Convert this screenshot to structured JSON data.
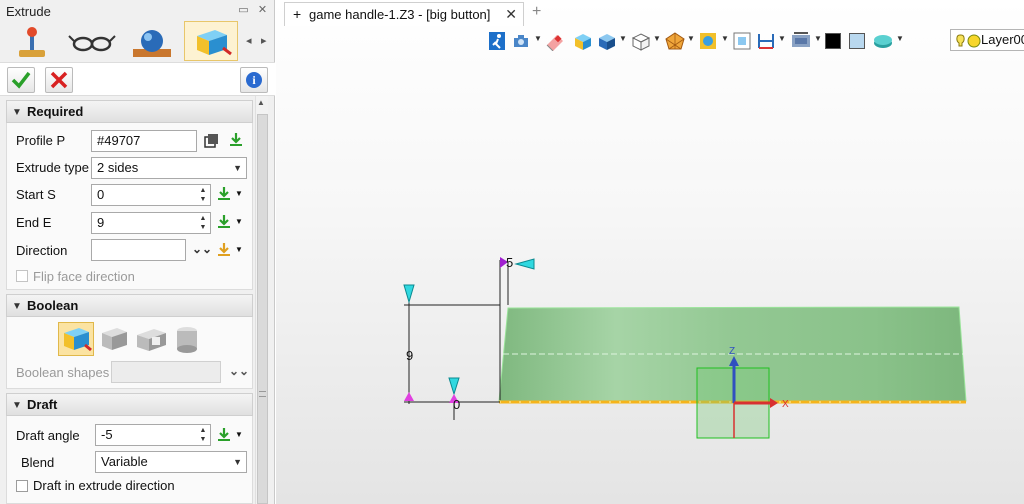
{
  "panel": {
    "title": "Extrude",
    "tabs": [
      "general-tab",
      "view-tab",
      "render-tab",
      "extrude-tab"
    ],
    "ok_icon": "check-icon",
    "cancel_icon": "x-icon",
    "info_icon": "info-icon"
  },
  "required": {
    "header": "Required",
    "profile_label": "Profile P",
    "profile_value": "#49707",
    "extrude_type_label": "Extrude type",
    "extrude_type_value": "2 sides",
    "start_label": "Start S",
    "start_value": "0",
    "end_label": "End E",
    "end_value": "9",
    "direction_label": "Direction",
    "direction_value": "",
    "flip_label": "Flip face direction"
  },
  "boolean": {
    "header": "Boolean",
    "shapes_label": "Boolean shapes",
    "modes": [
      "base",
      "add",
      "remove",
      "intersect"
    ]
  },
  "draft": {
    "header": "Draft",
    "angle_label": "Draft angle",
    "angle_value": "-5",
    "blend_label": "Blend",
    "blend_value": "Variable",
    "draft_dir_label": "Draft in extrude direction"
  },
  "document": {
    "tab_label": "game handle-1.Z3 - [big button]"
  },
  "toolbar": {
    "layer_label": "Layer00"
  },
  "viewport": {
    "dim_height": "9",
    "dim_end": "5",
    "dim_start": "0",
    "axis_z": "Z",
    "axis_x": "X",
    "body_color": "#8fc48f",
    "accent_color": "#f5b41a"
  }
}
